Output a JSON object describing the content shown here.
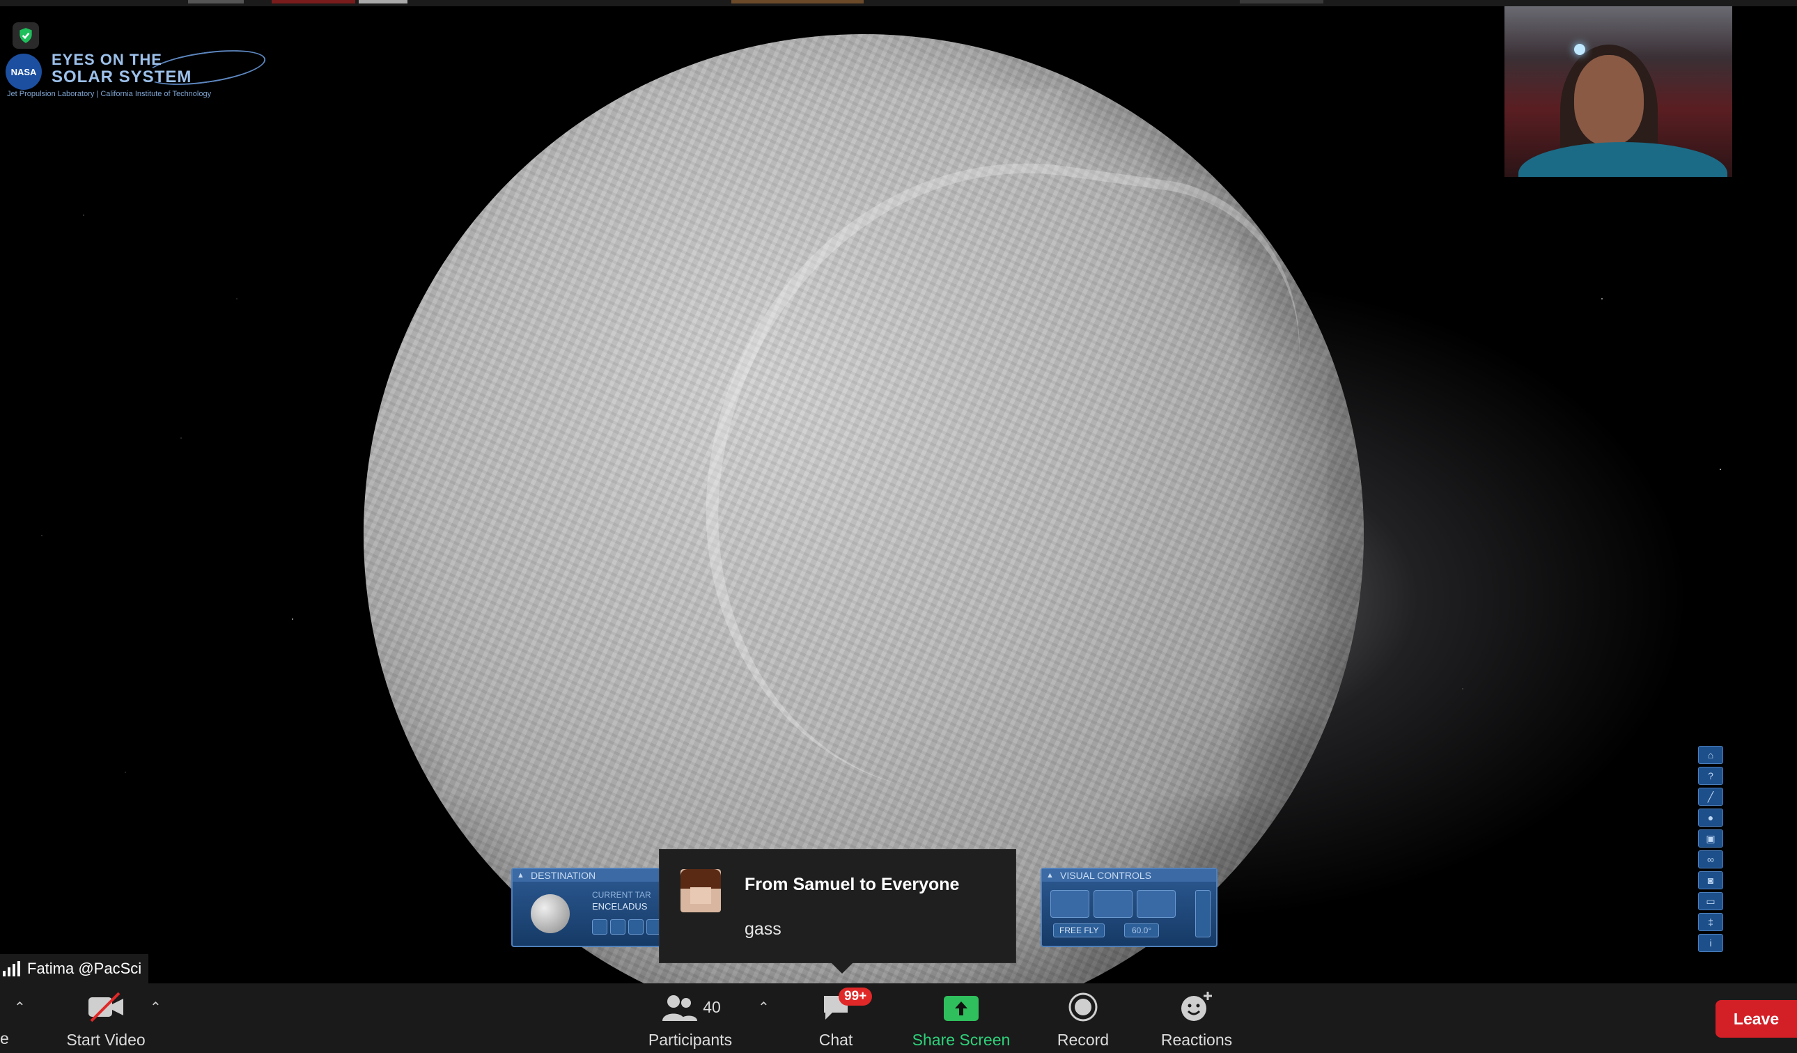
{
  "app": {
    "logo_line1": "EYES ON THE",
    "logo_line2": "SOLAR SYSTEM",
    "logo_sub": "Jet Propulsion Laboratory | California Institute of Technology",
    "nasa": "NASA"
  },
  "eyes_panels": {
    "destination_title": "DESTINATION",
    "current_target_label": "CURRENT TAR",
    "current_target_value": "ENCELADUS",
    "visual_title": "VISUAL CONTROLS",
    "free_fly": "FREE FLY",
    "fov": "60.0°"
  },
  "chat_popup": {
    "from": "From Samuel to Everyone",
    "message": "gass"
  },
  "participant_tag": {
    "name": "Fatima @PacSci"
  },
  "toolbar": {
    "edge_label": "e",
    "start_video": "Start Video",
    "participants_count": "40",
    "participants": "Participants",
    "chat": "Chat",
    "chat_badge": "99+",
    "share_screen": "Share Screen",
    "record": "Record",
    "reactions": "Reactions",
    "leave": "Leave"
  },
  "colors": {
    "toolbar_bg": "#1a1a1a",
    "share_accent": "#2fd17a",
    "leave_red": "#d32027",
    "badge_red": "#e02828"
  }
}
